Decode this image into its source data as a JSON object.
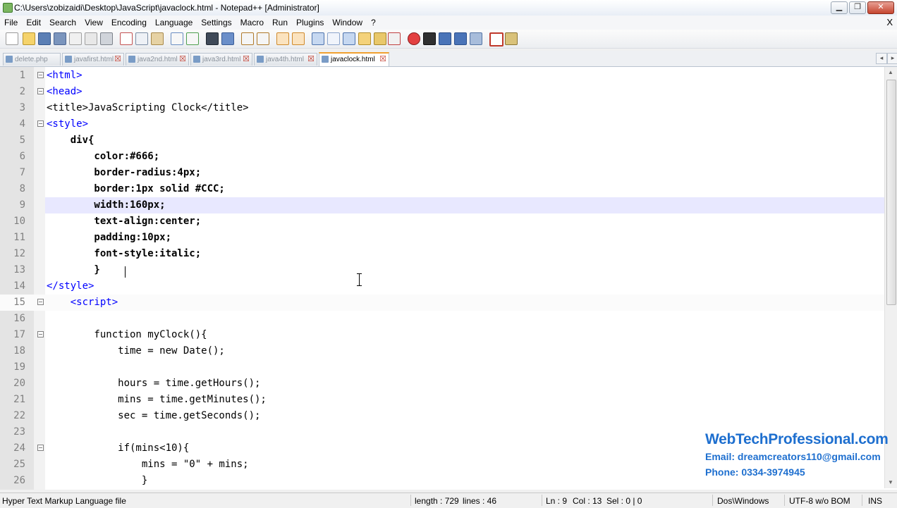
{
  "window": {
    "title": "C:\\Users\\zobizaidi\\Desktop\\JavaScript\\javaclock.html - Notepad++ [Administrator]",
    "minimize": "▁",
    "maximize": "❐",
    "close": "✕"
  },
  "menu": {
    "items": [
      "File",
      "Edit",
      "Search",
      "View",
      "Encoding",
      "Language",
      "Settings",
      "Macro",
      "Run",
      "Plugins",
      "Window",
      "?"
    ],
    "close_label": "X"
  },
  "tabs": [
    {
      "label": "delete.php",
      "active": false
    },
    {
      "label": "javafirst.html",
      "active": false
    },
    {
      "label": "java2nd.html",
      "active": false
    },
    {
      "label": "java3rd.html",
      "active": false
    },
    {
      "label": "java4th.html",
      "active": false
    },
    {
      "label": "javaclock.html",
      "active": true
    }
  ],
  "tab_nav": {
    "left": "◂",
    "right": "▸"
  },
  "editor": {
    "current_line": 9,
    "lines": [
      {
        "n": "1",
        "text": "<html>"
      },
      {
        "n": "2",
        "text": "<head>"
      },
      {
        "n": "3",
        "text": "<title>JavaScripting Clock</title>"
      },
      {
        "n": "4",
        "text": "<style>"
      },
      {
        "n": "5",
        "text": "    div{"
      },
      {
        "n": "6",
        "text": "        color:#666;"
      },
      {
        "n": "7",
        "text": "        border-radius:4px;"
      },
      {
        "n": "8",
        "text": "        border:1px solid #CCC;"
      },
      {
        "n": "9",
        "text": "        width:160px;"
      },
      {
        "n": "10",
        "text": "        text-align:center;"
      },
      {
        "n": "11",
        "text": "        padding:10px;"
      },
      {
        "n": "12",
        "text": "        font-style:italic;"
      },
      {
        "n": "13",
        "text": "        }"
      },
      {
        "n": "14",
        "text": "</style>"
      },
      {
        "n": "15",
        "text": "    <script>"
      },
      {
        "n": "16",
        "text": ""
      },
      {
        "n": "17",
        "text": "        function myClock(){"
      },
      {
        "n": "18",
        "text": "            time = new Date();"
      },
      {
        "n": "19",
        "text": ""
      },
      {
        "n": "20",
        "text": "            hours = time.getHours();"
      },
      {
        "n": "21",
        "text": "            mins = time.getMinutes();"
      },
      {
        "n": "22",
        "text": "            sec = time.getSeconds();"
      },
      {
        "n": "23",
        "text": ""
      },
      {
        "n": "24",
        "text": "            if(mins<10){"
      },
      {
        "n": "25",
        "text": "                mins = \"0\" + mins;"
      },
      {
        "n": "26",
        "text": "                }"
      }
    ]
  },
  "watermark": {
    "site": "WebTechProfessional.com",
    "email": "Email: dreamcreators110@gmail.com",
    "phone": "Phone: 0334-3974945"
  },
  "status": {
    "filetype": "Hyper Text Markup Language file",
    "length": "length : 729",
    "lines": "lines : 46",
    "ln": "Ln : 9",
    "col": "Col : 13",
    "sel": "Sel : 0 | 0",
    "eol": "Dos\\Windows",
    "encoding": "UTF-8 w/o BOM",
    "mode": "INS"
  },
  "icons": {
    "app": "notepad-plus-plus-icon",
    "toolbar": [
      "new-file-icon",
      "open-file-icon",
      "save-icon",
      "save-all-icon",
      "close-icon",
      "close-all-icon",
      "print-icon",
      "cut-icon",
      "copy-icon",
      "paste-icon",
      "undo-icon",
      "redo-icon",
      "find-icon",
      "replace-icon",
      "zoom-in-icon",
      "zoom-out-icon",
      "sync-vertical-icon",
      "sync-horizontal-icon",
      "word-wrap-icon",
      "show-all-chars-icon",
      "indent-guide-icon",
      "user-language-icon",
      "doc-map-icon",
      "function-list-icon",
      "record-macro-icon",
      "stop-record-icon",
      "play-macro-icon",
      "run-macro-multiple-icon",
      "save-macro-icon",
      "spell-check-icon",
      "plugin-icon"
    ]
  }
}
